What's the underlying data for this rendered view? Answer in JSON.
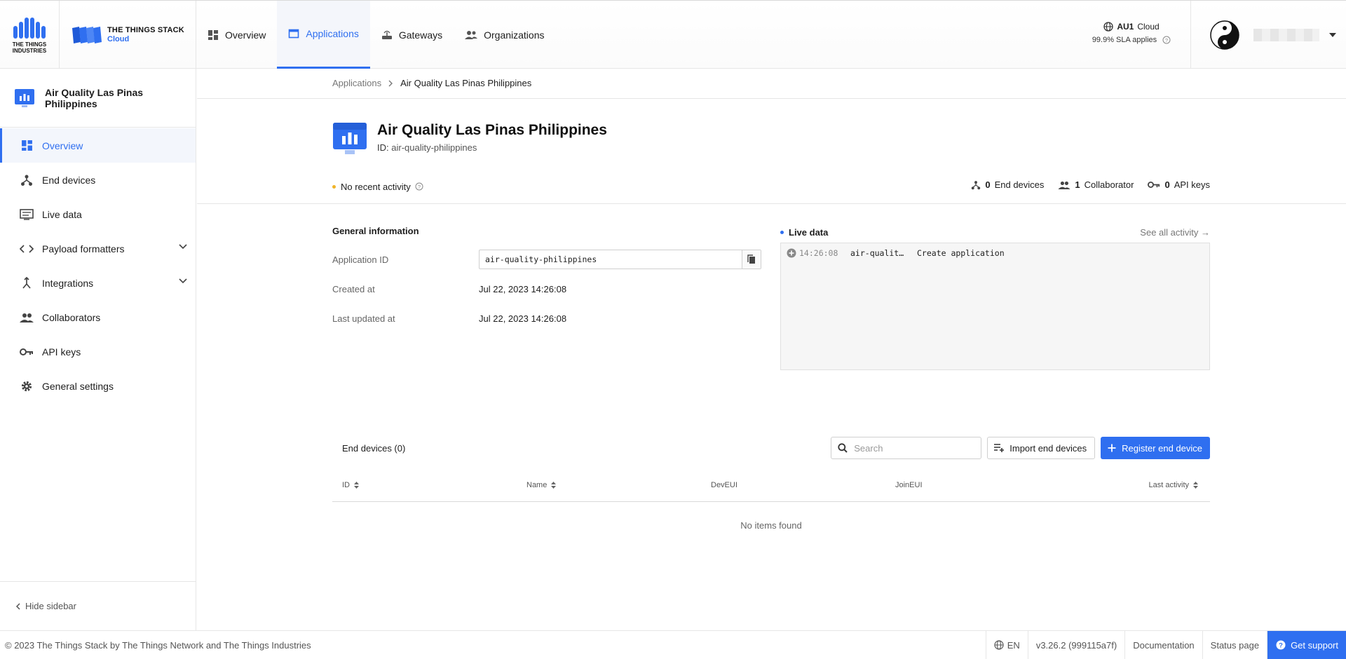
{
  "brand": {
    "tti_text": "THE THINGS INDUSTRIES",
    "stack_line1": "THE THINGS STACK",
    "stack_line2": "Cloud"
  },
  "nav": {
    "items": [
      {
        "label": "Overview",
        "icon": "dashboard-icon"
      },
      {
        "label": "Applications",
        "icon": "application-icon"
      },
      {
        "label": "Gateways",
        "icon": "gateway-icon"
      },
      {
        "label": "Organizations",
        "icon": "organization-icon"
      }
    ],
    "active": "Applications"
  },
  "cluster": {
    "name": "AU1",
    "suffix": "Cloud",
    "sla": "99.9% SLA applies"
  },
  "sidebar": {
    "app_name": "Air Quality Las Pinas Philippines",
    "items": [
      {
        "label": "Overview"
      },
      {
        "label": "End devices"
      },
      {
        "label": "Live data"
      },
      {
        "label": "Payload formatters"
      },
      {
        "label": "Integrations"
      },
      {
        "label": "Collaborators"
      },
      {
        "label": "API keys"
      },
      {
        "label": "General settings"
      }
    ],
    "hide_label": "Hide sidebar"
  },
  "breadcrumb": {
    "root": "Applications",
    "current": "Air Quality Las Pinas Philippines"
  },
  "app": {
    "title": "Air Quality Las Pinas Philippines",
    "id_label": "ID:",
    "id_value": "air-quality-philippines",
    "activity": "No recent activity",
    "stats": {
      "end_devices_count": "0",
      "end_devices_label": "End devices",
      "collaborators_count": "1",
      "collaborators_label": "Collaborator",
      "api_keys_count": "0",
      "api_keys_label": "API keys"
    }
  },
  "general_info": {
    "title": "General information",
    "app_id_label": "Application ID",
    "app_id_value": "air-quality-philippines",
    "created_label": "Created at",
    "created_value": "Jul 22, 2023 14:26:08",
    "updated_label": "Last updated at",
    "updated_value": "Jul 22, 2023 14:26:08"
  },
  "live_data": {
    "title": "Live data",
    "see_all": "See all activity →",
    "events": [
      {
        "time": "14:26:08",
        "device": "air-qualit…",
        "message": "Create application"
      }
    ]
  },
  "end_devices": {
    "title": "End devices (0)",
    "search_placeholder": "Search",
    "import_label": "Import end devices",
    "register_label": "Register end device",
    "columns": [
      "ID",
      "Name",
      "DevEUI",
      "JoinEUI",
      "Last activity"
    ],
    "empty": "No items found"
  },
  "footer": {
    "copyright": "© 2023 The Things Stack by The Things Network and The Things Industries",
    "lang": "EN",
    "version": "v3.26.2 (999115a7f)",
    "docs": "Documentation",
    "status": "Status page",
    "support": "Get support"
  },
  "colors": {
    "accent": "#2f6ff0",
    "activity_dot": "#f0b429"
  }
}
